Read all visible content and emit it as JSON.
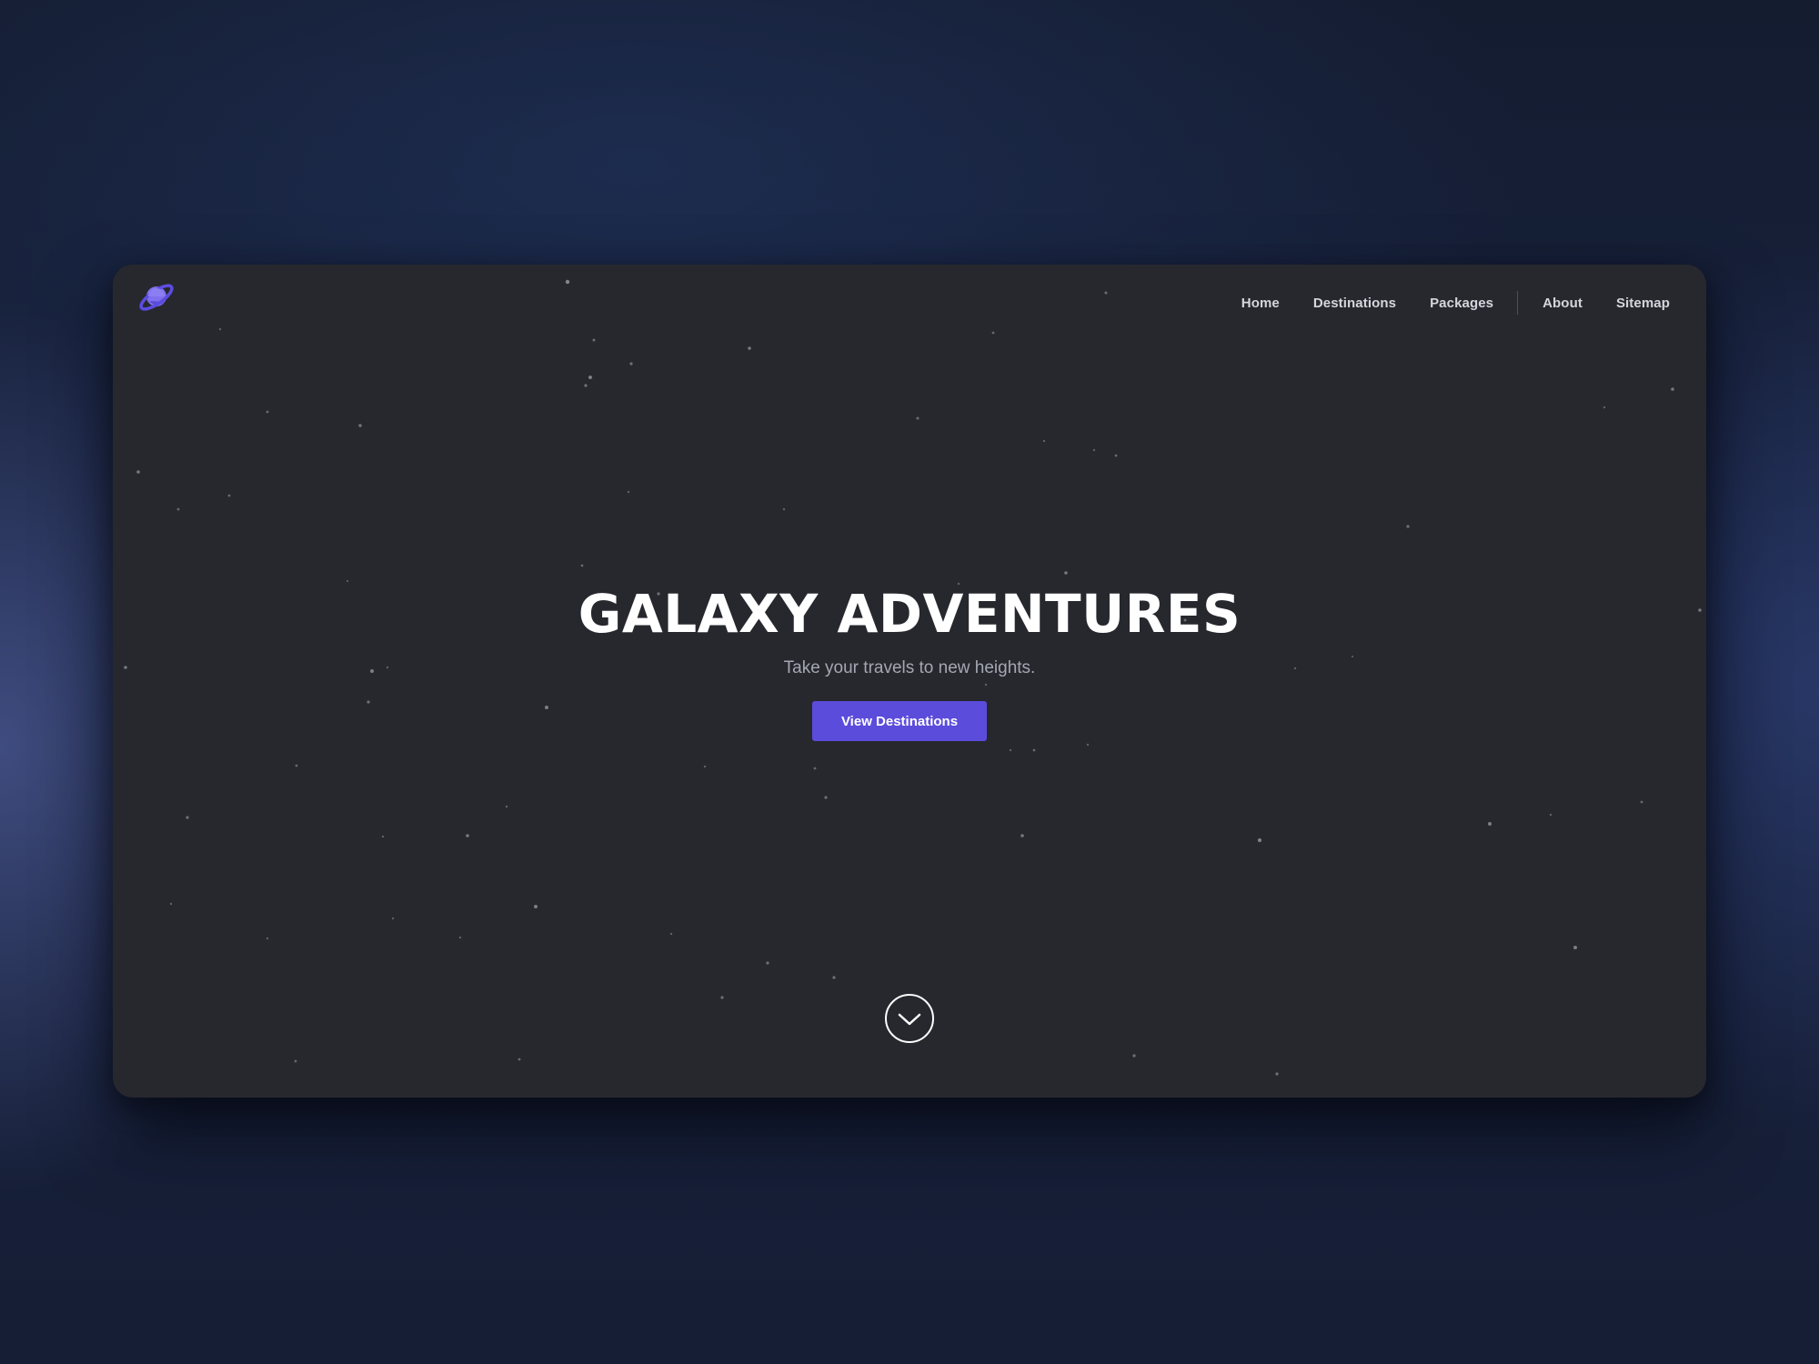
{
  "brand": {
    "logo_icon": "planet-icon",
    "logo_color": "#6b5ce7"
  },
  "nav": {
    "items": [
      {
        "label": "Home"
      },
      {
        "label": "Destinations"
      },
      {
        "label": "Packages"
      },
      {
        "label": "About"
      },
      {
        "label": "Sitemap"
      }
    ]
  },
  "hero": {
    "title": "GALAXY ADVENTURES",
    "subtitle": "Take your travels to new heights.",
    "cta_label": "View Destinations",
    "cta_color": "#5b4cdc",
    "scroll_icon": "chevron-down-circle-icon"
  },
  "colors": {
    "window_background": "#27282e",
    "page_background": "#172038",
    "star": "#8a8c95"
  }
}
